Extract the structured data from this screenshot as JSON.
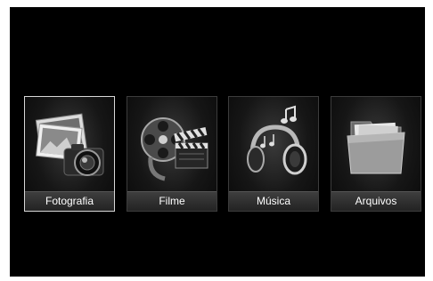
{
  "menu": {
    "items": [
      {
        "label": "Fotografia",
        "icon": "photo-camera-icon",
        "selected": true
      },
      {
        "label": "Filme",
        "icon": "film-reel-icon",
        "selected": false
      },
      {
        "label": "Música",
        "icon": "headphones-icon",
        "selected": false
      },
      {
        "label": "Arquivos",
        "icon": "folder-icon",
        "selected": false
      }
    ]
  },
  "colors": {
    "background": "#000000",
    "tile_border": "#3c3c3c",
    "selected_border": "#d8d8d8",
    "label_text": "#ffffff"
  }
}
